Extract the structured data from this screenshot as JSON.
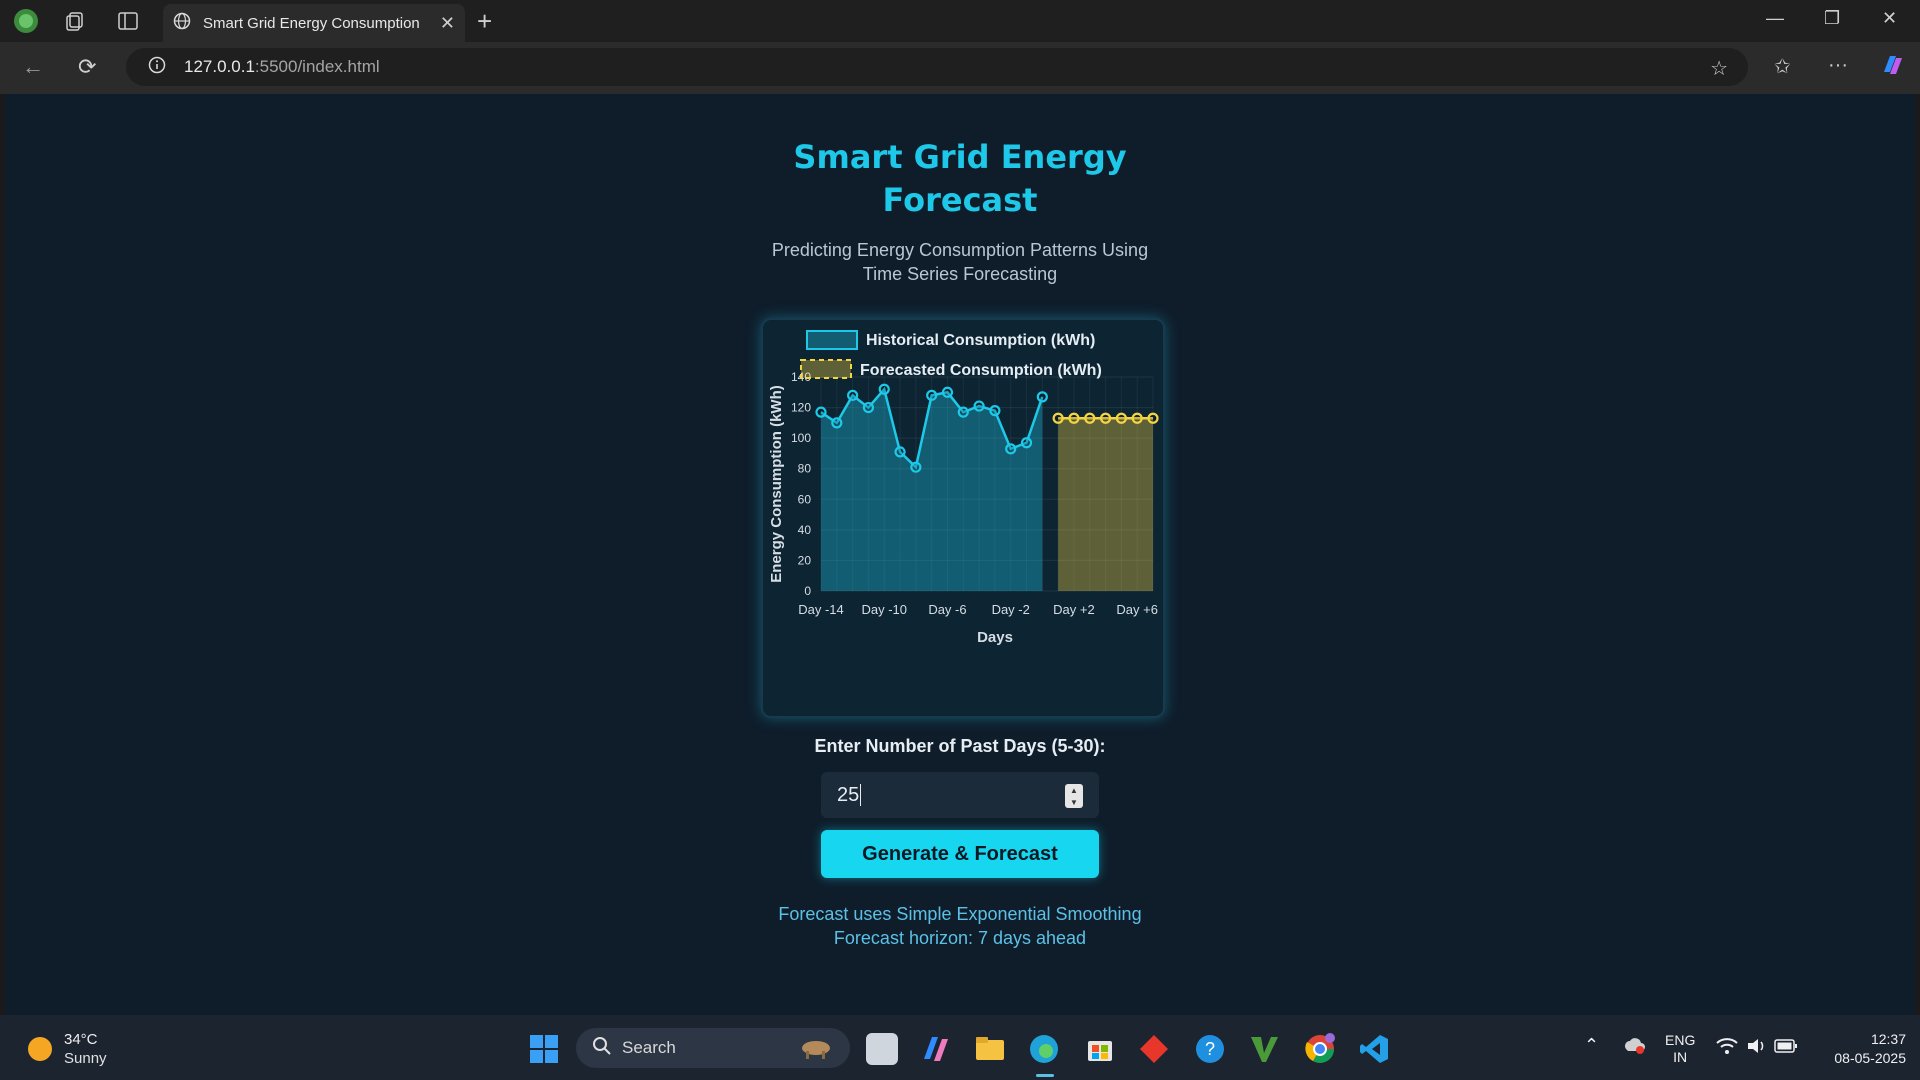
{
  "browser": {
    "tab_title": "Smart Grid Energy Consumption F",
    "url_host": "127.0.0.1",
    "url_path": ":5500/index.html"
  },
  "page": {
    "title_line1": "Smart Grid Energy",
    "title_line2": "Forecast",
    "subtitle_line1": "Predicting Energy Consumption Patterns Using",
    "subtitle_line2": "Time Series Forecasting",
    "input_label": "Enter Number of Past Days (5-30):",
    "input_value": "25",
    "button_label": "Generate & Forecast",
    "note1": "Forecast uses Simple Exponential Smoothing",
    "note2": "Forecast horizon: 7 days ahead"
  },
  "chart_data": {
    "type": "line",
    "legend": [
      "Historical Consumption (kWh)",
      "Forecasted Consumption (kWh)"
    ],
    "ylabel": "Energy Consumption (kWh)",
    "xlabel": "Days",
    "ylim": [
      0,
      140
    ],
    "yticks": [
      "0",
      "20",
      "40",
      "60",
      "80",
      "100",
      "120",
      "140"
    ],
    "xticks": [
      "Day -14",
      "Day -10",
      "Day -6",
      "Day -2",
      "Day +2",
      "Day +6"
    ],
    "x": [
      -14,
      -13,
      -12,
      -11,
      -10,
      -9,
      -8,
      -7,
      -6,
      -5,
      -4,
      -3,
      -2,
      -1,
      0,
      1,
      2,
      3,
      4,
      5,
      6,
      7
    ],
    "series": [
      {
        "name": "Historical Consumption (kWh)",
        "x_start": -14,
        "values": [
          117,
          110,
          128,
          120,
          132,
          91,
          81,
          128,
          130,
          117,
          121,
          118,
          93,
          97,
          127
        ],
        "color": "#1ec8e8"
      },
      {
        "name": "Forecasted Consumption (kWh)",
        "x_start": 1,
        "values": [
          113,
          113,
          113,
          113,
          113,
          113,
          113
        ],
        "color": "#f5d442"
      }
    ]
  },
  "taskbar": {
    "temp": "34°C",
    "condition": "Sunny",
    "search_label": "Search",
    "lang_top": "ENG",
    "lang_bottom": "IN",
    "time": "12:37",
    "date": "08-05-2025"
  }
}
